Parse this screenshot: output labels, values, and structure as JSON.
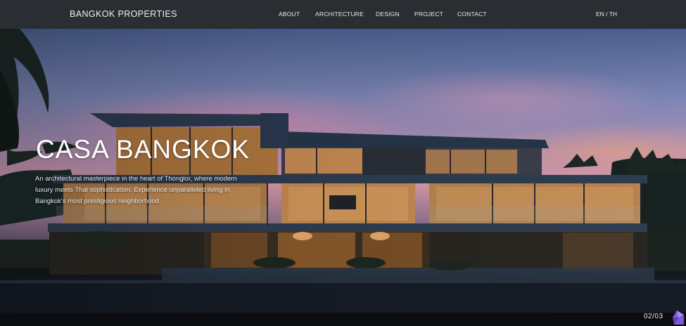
{
  "header": {
    "brand": "BANGKOK PROPERTIES",
    "nav": [
      "ABOUT",
      "ARCHITECTURE",
      "DESIGN",
      "PROJECT",
      "CONTACT"
    ],
    "language": "EN / TH"
  },
  "hero": {
    "title": "CASA BANGKOK",
    "description": "An architectural masterpiece in the heart of Thonglor, where modern luxury meets Thai sophistication. Experience unparalleled living in Bangkok's most prestigious neighborhood."
  },
  "slider": {
    "counter": "02/03"
  },
  "colors": {
    "navbar": "#2a2d31",
    "text": "#ffffff",
    "warm_light": "#f2b673"
  }
}
